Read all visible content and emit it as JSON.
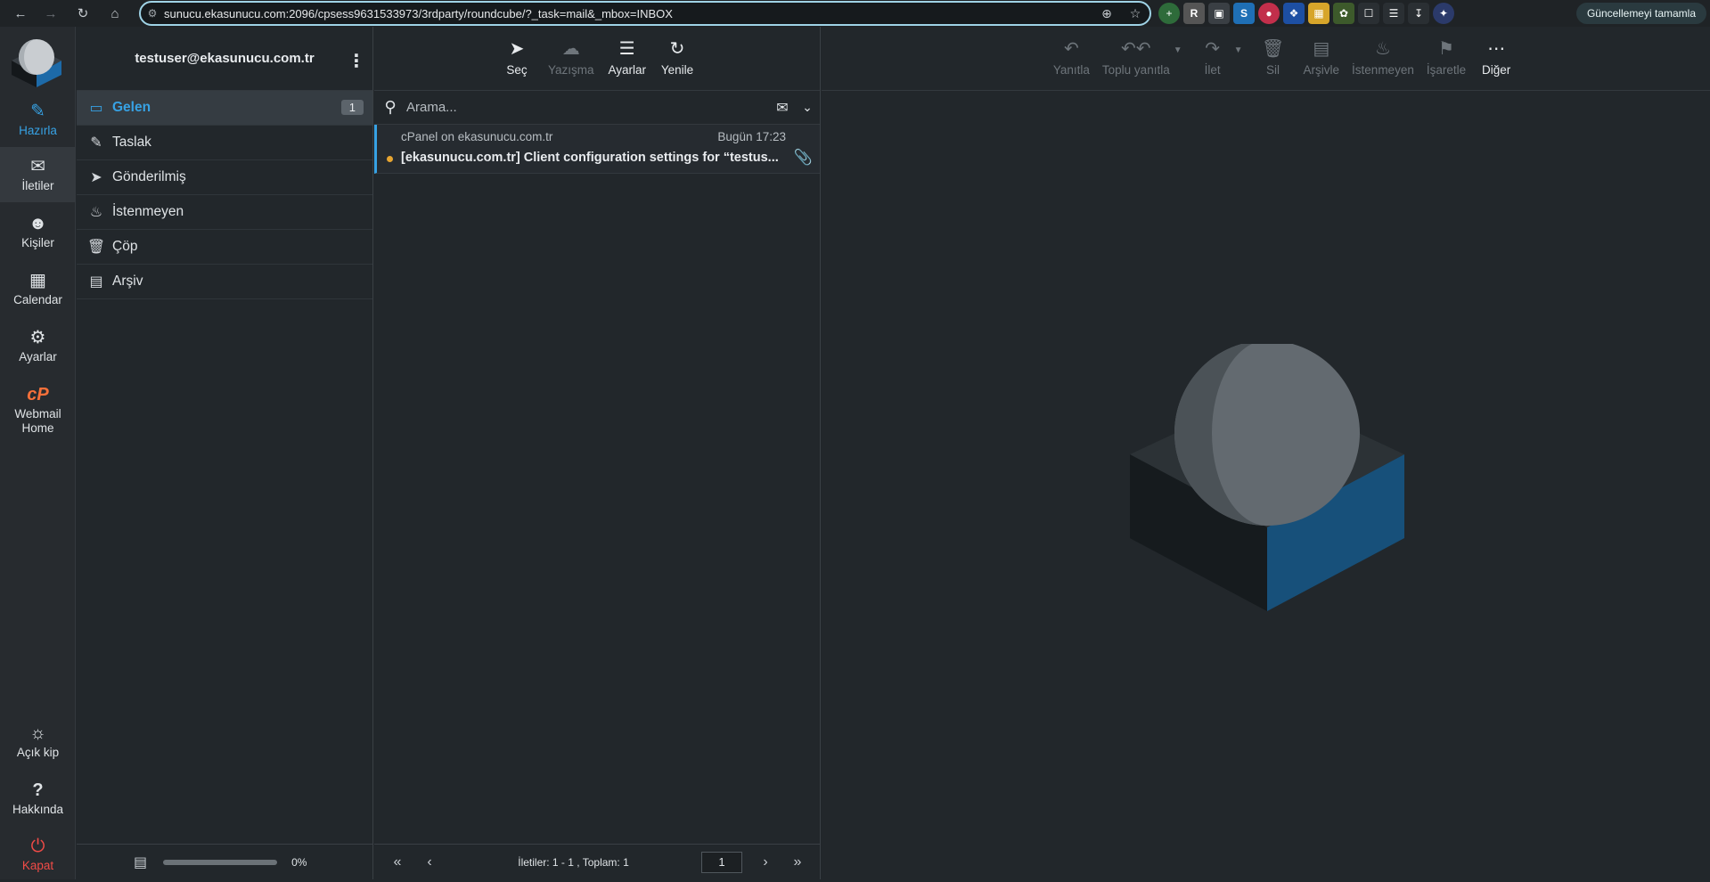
{
  "browser": {
    "url": "sunucu.ekasunucu.com:2096/cpsess9631533973/3rdparty/roundcube/?_task=mail&_mbox=INBOX",
    "update_button": "Güncellemeyi tamamla"
  },
  "taskmenu": {
    "compose": "Hazırla",
    "mail": "İletiler",
    "contacts": "Kişiler",
    "calendar": "Calendar",
    "settings": "Ayarlar",
    "webmail_home": "Webmail Home",
    "mode": "Açık kip",
    "about": "Hakkında",
    "logout": "Kapat"
  },
  "account": {
    "email": "testuser@ekasunucu.com.tr"
  },
  "folders": [
    {
      "name": "Gelen",
      "icon": "inbox-icon",
      "unread": "1"
    },
    {
      "name": "Taslak",
      "icon": "pencil-icon"
    },
    {
      "name": "Gönderilmiş",
      "icon": "paper-plane-icon"
    },
    {
      "name": "İstenmeyen",
      "icon": "fire-icon"
    },
    {
      "name": "Çöp",
      "icon": "trash-icon"
    },
    {
      "name": "Arşiv",
      "icon": "archive-icon"
    }
  ],
  "quota": {
    "percent": "0%",
    "fraction": 0
  },
  "list_toolbar": {
    "select": "Seç",
    "threads": "Yazışma",
    "options": "Ayarlar",
    "refresh": "Yenile"
  },
  "search": {
    "placeholder": "Arama..."
  },
  "messages": [
    {
      "from": "cPanel on ekasunucu.com.tr",
      "date": "Bugün 17:23",
      "subject": "[ekasunucu.com.tr] Client configuration settings for “testus..."
    }
  ],
  "list_footer": {
    "count": "İletiler: 1 - 1 , Toplam: 1",
    "page": "1"
  },
  "content_toolbar": {
    "reply": "Yanıtla",
    "reply_all": "Toplu yanıtla",
    "forward": "İlet",
    "delete": "Sil",
    "archive": "Arşivle",
    "spam": "İstenmeyen",
    "mark": "İşaretle",
    "more": "Diğer"
  },
  "colors": {
    "accent": "#37a2e4",
    "logout": "#f04b47",
    "unread_dot": "#e6a531",
    "background": "#22272b"
  }
}
